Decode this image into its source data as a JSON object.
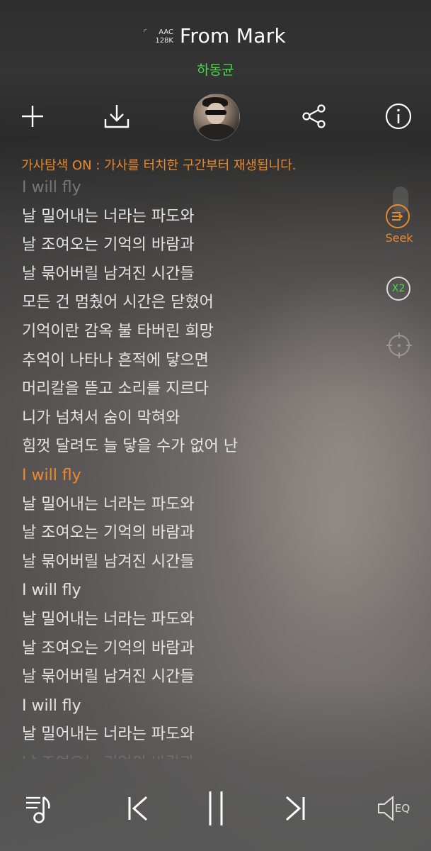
{
  "header": {
    "codec": "AAC",
    "bitrate": "128K",
    "title": "From Mark",
    "artist": "하동균"
  },
  "toolbar": {
    "add_icon": "plus-icon",
    "download_icon": "download-icon",
    "share_icon": "share-icon",
    "info_icon": "info-icon"
  },
  "notice": "가사탐색 ON : 가사를 터치한 구간부터 재생됩니다.",
  "lyrics": [
    {
      "text": "I will fly",
      "state": "faded-top"
    },
    {
      "text": "날 밀어내는 너라는 파도와",
      "state": "normal"
    },
    {
      "text": "날 조여오는 기억의 바람과",
      "state": "normal"
    },
    {
      "text": "날 묶어버릴 남겨진 시간들",
      "state": "normal"
    },
    {
      "text": "모든 건 멈췄어 시간은 닫혔어",
      "state": "normal"
    },
    {
      "text": "기억이란 감옥 불 타버린 희망",
      "state": "normal"
    },
    {
      "text": "추억이 나타나 흔적에 닿으면",
      "state": "normal"
    },
    {
      "text": "머리칼을 뜯고 소리를 지르다",
      "state": "normal"
    },
    {
      "text": "니가 넘쳐서 숨이 막혀와",
      "state": "normal"
    },
    {
      "text": "힘껏 달려도 늘 닿을 수가 없어 난",
      "state": "normal"
    },
    {
      "text": "I will fly",
      "state": "active"
    },
    {
      "text": "날 밀어내는 너라는 파도와",
      "state": "normal"
    },
    {
      "text": "날 조여오는 기억의 바람과",
      "state": "normal"
    },
    {
      "text": "날 묶어버릴 남겨진 시간들",
      "state": "normal"
    },
    {
      "text": "I will fly",
      "state": "normal"
    },
    {
      "text": "날 밀어내는 너라는 파도와",
      "state": "normal"
    },
    {
      "text": "날 조여오는 기억의 바람과",
      "state": "normal"
    },
    {
      "text": "날 묶어버릴 남겨진 시간들",
      "state": "normal"
    },
    {
      "text": "I will fly",
      "state": "normal"
    },
    {
      "text": "날 밀어내는 너라는 파도와",
      "state": "normal"
    },
    {
      "text": "날 조여오는 기억의 바람과",
      "state": "faded-bottom"
    }
  ],
  "side": {
    "seek_label": "Seek",
    "speed_label": "X2"
  },
  "controls": {
    "eq_label": "EQ"
  },
  "colors": {
    "accent_orange": "#e98a2e",
    "artist_green": "#4bd84b"
  }
}
